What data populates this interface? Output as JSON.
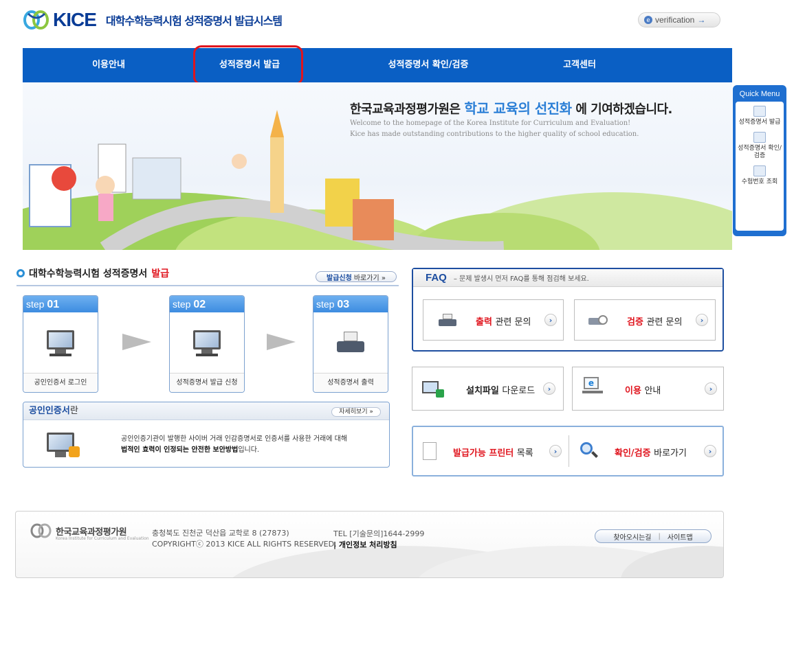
{
  "header": {
    "logo_text": "KICE",
    "system_title": "대학수학능력시험 성적증명서 발급시스템",
    "verification_button": "verification"
  },
  "nav": {
    "items": [
      "이용안내",
      "성적증명서 발급",
      "성적증명서 확인/검증",
      "고객센터"
    ]
  },
  "banner": {
    "title_prefix": "한국교육과정평가원은",
    "title_highlight": "학교 교육의 선진화",
    "title_suffix": "에 기여하겠습니다.",
    "en_line1": "Welcome to the homepage of the Korea Institute for Curriculum and Evaluation!",
    "en_line2": "Kice has made outstanding contributions to the higher quality of school education."
  },
  "quick_menu": {
    "title": "Quick Menu",
    "items": [
      "성적증명서 발급",
      "성적증명서 확인/검증",
      "수험번호 조회"
    ]
  },
  "issue_section": {
    "title_prefix": "대학수학능력시험 성적증명서",
    "title_highlight": "발급",
    "apply_bold": "발급신청",
    "apply_rest": "바로가기 »",
    "steps": [
      {
        "label": "step",
        "num": "01",
        "caption": "공인인증서 로그인"
      },
      {
        "label": "step",
        "num": "02",
        "caption": "성적증명서 발급 신청"
      },
      {
        "label": "step",
        "num": "03",
        "caption": "성적증명서 출력"
      }
    ]
  },
  "cert_box": {
    "title_bold": "공인인증서",
    "title_rest": "란",
    "more_button": "자세히보기 »",
    "line1": "공인인증기관이 발행한 사이버 거래 인감증명서로 인증서를 사용한 거래에 대해",
    "line2_bold": "법적인 효력이 인정되는 안전한 보안방법",
    "line2_rest": "입니다."
  },
  "faq": {
    "title": "FAQ",
    "desc": "– 문제 발생시 먼저 FAQ를 통해 점검해 보세요.",
    "cards": [
      {
        "red": "출력",
        "rest": "관련 문의"
      },
      {
        "red": "검증",
        "rest": "관련 문의"
      }
    ]
  },
  "links": {
    "download_bold": "설치파일",
    "download_rest": "다운로드",
    "guide_red": "이용",
    "guide_rest": "안내",
    "printer_red": "발급가능 프린터",
    "printer_rest": "목록",
    "verify_red": "확인/검증",
    "verify_rest": "바로가기"
  },
  "footer": {
    "org_name": "한국교육과정평가원",
    "org_sub": "Korea Institute for Curriculum and Evaluation",
    "address": "충청북도 진천군 덕산읍 교학로 8 (27873)",
    "copyright": "COPYRIGHTⓒ 2013 KICE ALL RIGHTS RESERVED.",
    "tel": "TEL [기술문의]1644-2999",
    "privacy": "| 개인정보 처리방침",
    "btn_directions": "찾아오시는길",
    "btn_sitemap": "사이트맵"
  },
  "colors": {
    "nav_blue": "#0a5fc4",
    "brand_navy": "#0a3c96",
    "accent_red": "#e0151e"
  }
}
